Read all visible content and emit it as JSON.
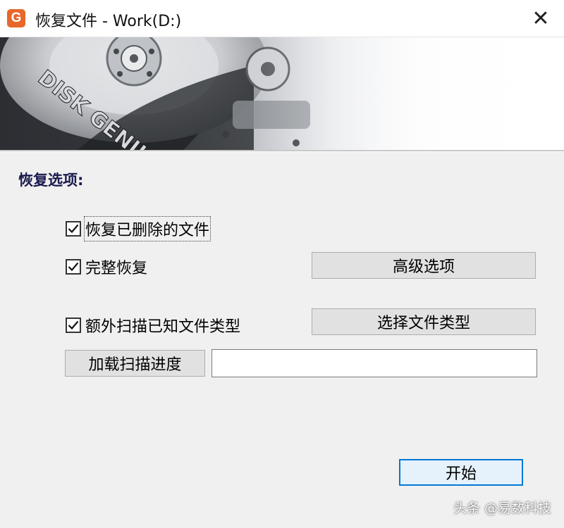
{
  "window": {
    "title": "恢复文件 - Work(D:)",
    "app_icon_glyph": "G",
    "close_glyph": "✕"
  },
  "banner": {
    "brand_text": "DISK GENIUS"
  },
  "options": {
    "section_label": "恢复选项:",
    "recover_deleted": {
      "label": "恢复已删除的文件",
      "checked": true
    },
    "full_recovery": {
      "label": "完整恢复",
      "checked": true
    },
    "extra_scan": {
      "label": "额外扫描已知文件类型",
      "checked": true
    },
    "advanced_button": "高级选项",
    "select_types_button": "选择文件类型",
    "load_progress_button": "加载扫描进度",
    "progress_path_value": ""
  },
  "footer": {
    "start_button": "开始"
  },
  "watermark": "头条 @易数科技",
  "colors": {
    "app_icon": "#e8672a",
    "section_label": "#1a1a4e",
    "primary_border": "#0078d7",
    "dialog_bg": "#f0f0f0"
  },
  "icons": [
    "app-icon",
    "close-icon",
    "checkmark-icon"
  ]
}
